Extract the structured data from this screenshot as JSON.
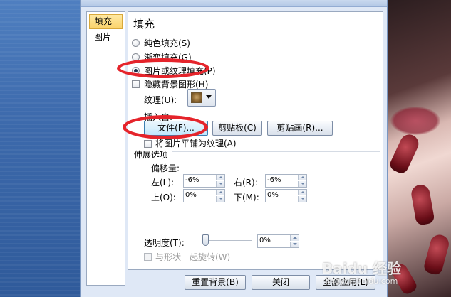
{
  "nav": {
    "items": [
      {
        "label": "填充"
      },
      {
        "label": "图片"
      }
    ]
  },
  "panel": {
    "title": "填充",
    "options": [
      {
        "label": "纯色填充(S)"
      },
      {
        "label": "渐变填充(G)"
      },
      {
        "label": "图片或纹理填充(P)"
      },
      {
        "label": "隐藏背景图形(H)"
      }
    ],
    "texture_label": "纹理(U):",
    "insert_from_label": "插入自:",
    "buttons": {
      "file": "文件(F)...",
      "clipboard": "剪贴板(C)",
      "clipart": "剪贴画(R)..."
    },
    "tile_label": "将图片平铺为纹理(A)",
    "stretch_label": "伸展选项",
    "offset_label": "偏移量:",
    "offsets": {
      "left": {
        "label": "左(L):",
        "value": "-6%"
      },
      "right": {
        "label": "右(R):",
        "value": "-6%"
      },
      "top": {
        "label": "上(O):",
        "value": "0%"
      },
      "bottom": {
        "label": "下(M):",
        "value": "0%"
      }
    },
    "transparency_label": "透明度(T):",
    "transparency_value": "0%",
    "rotate_label": "与形状一起旋转(W)"
  },
  "footer": {
    "reset": "重置背景(B)",
    "close": "关闭",
    "apply_all": "全部应用(L)"
  },
  "watermark": {
    "text": "Baidu 经验",
    "sub": "jingyan.baidu.com"
  },
  "colors": {
    "annotation": "#e5242b",
    "selected_nav": "#fbd36b"
  }
}
